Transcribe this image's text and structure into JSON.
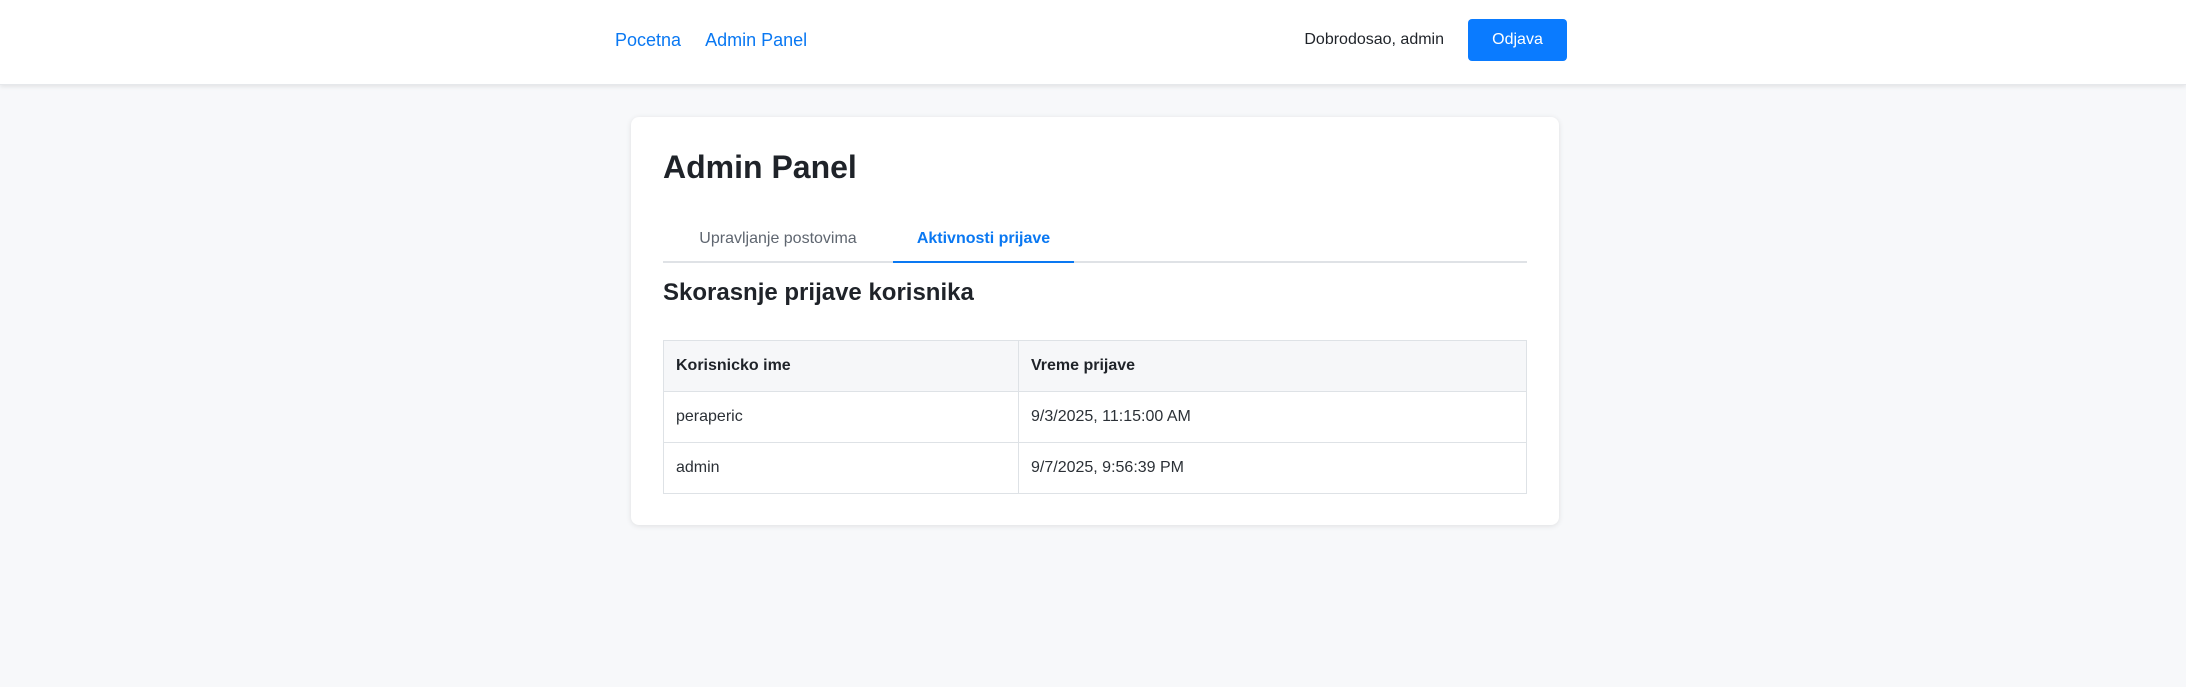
{
  "nav": {
    "links": [
      "Pocetna",
      "Admin Panel"
    ],
    "welcome": "Dobrodosao, admin",
    "logout_label": "Odjava"
  },
  "page": {
    "title": "Admin Panel",
    "tabs": [
      {
        "label": "Upravljanje postovima",
        "active": false
      },
      {
        "label": "Aktivnosti prijave",
        "active": true
      }
    ],
    "section_title": "Skorasnje prijave korisnika"
  },
  "logins_table": {
    "headers": [
      "Korisnicko ime",
      "Vreme prijave"
    ],
    "rows": [
      [
        "peraperic",
        "9/3/2025, 11:15:00 AM"
      ],
      [
        "admin",
        "9/7/2025, 9:56:39 PM"
      ]
    ]
  },
  "colors": {
    "accent": "#0a7bff",
    "link": "#0a78f2",
    "background": "#f7f8fa"
  }
}
